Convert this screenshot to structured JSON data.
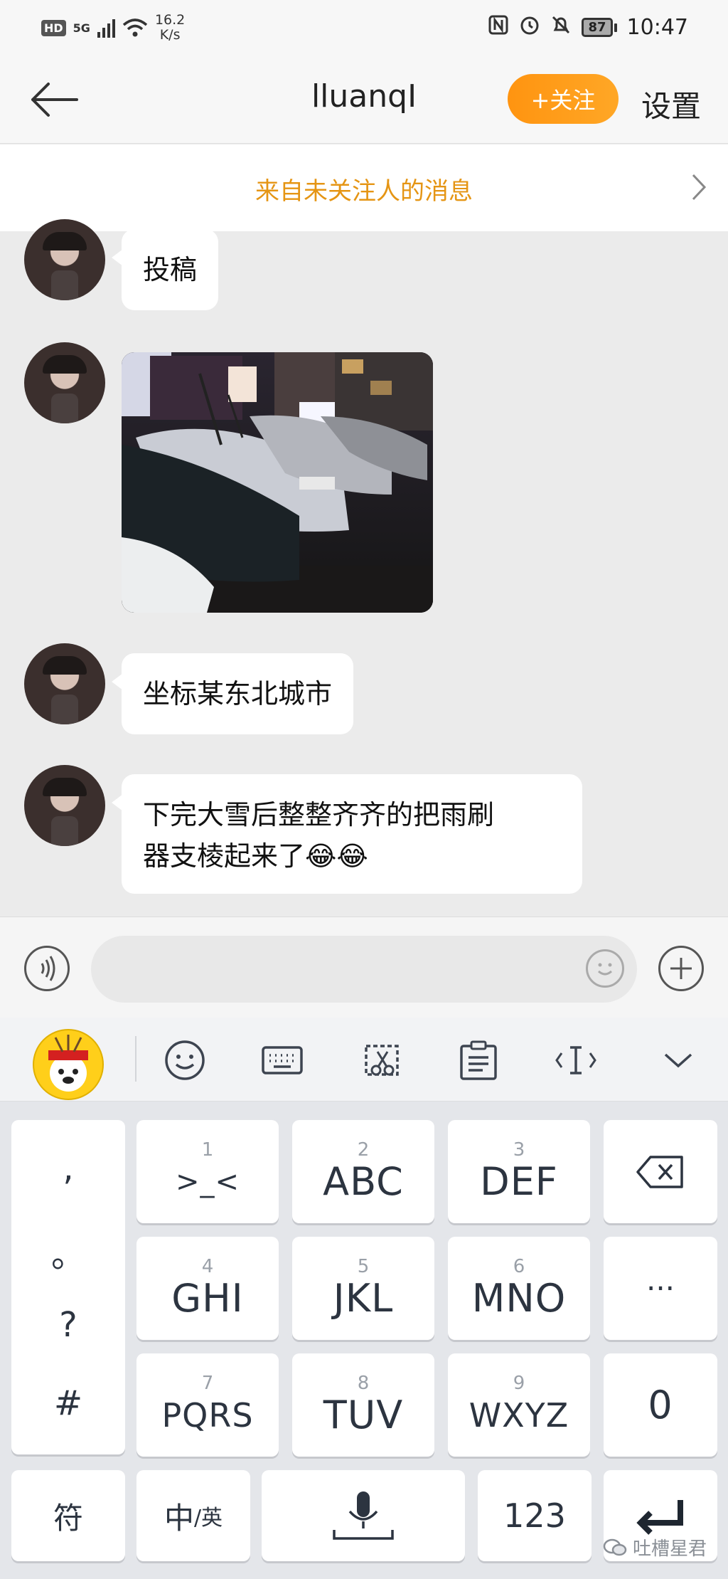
{
  "status_bar": {
    "hd": "HD",
    "network": "5G",
    "speed_value": "16.2",
    "speed_unit": "K/s",
    "nfc_icon": "nfc-icon",
    "alarm_icon": "alarm-icon",
    "mute_icon": "bell-off-icon",
    "battery": "87",
    "time": "10:47"
  },
  "header": {
    "back_icon": "back-arrow-icon",
    "title": "lluanqI",
    "follow_label": "+关注",
    "settings_label": "设置"
  },
  "banner": {
    "text": "来自未关注人的消息"
  },
  "messages": [
    {
      "type": "text",
      "text": "投稿"
    },
    {
      "type": "image",
      "alt": "parked cars at night"
    },
    {
      "type": "text",
      "text": "坐标某东北城市"
    },
    {
      "type": "text",
      "line1": "下完大雪后整整齐齐的把雨刷",
      "line2": "器支棱起来了😂😂"
    }
  ],
  "input_bar": {
    "voice_icon": "voice-icon",
    "placeholder": "",
    "emoji_icon": "emoji-icon",
    "plus_icon": "plus-icon"
  },
  "keyboard_toolbar": {
    "items": [
      "emoji-face-icon",
      "keyboard-icon",
      "clipboard-cut-icon",
      "clipboard-icon",
      "cursor-icon",
      "collapse-chevron-icon"
    ]
  },
  "keyboard": {
    "punctuation": [
      ",",
      "。",
      "?",
      "#"
    ],
    "row1": [
      {
        "num": "1",
        "label": ">_<"
      },
      {
        "num": "2",
        "label": "ABC"
      },
      {
        "num": "3",
        "label": "DEF"
      }
    ],
    "row2": [
      {
        "num": "4",
        "label": "GHI"
      },
      {
        "num": "5",
        "label": "JKL"
      },
      {
        "num": "6",
        "label": "MNO"
      }
    ],
    "row3": [
      {
        "num": "7",
        "label": "PQRS"
      },
      {
        "num": "8",
        "label": "TUV"
      },
      {
        "num": "9",
        "label": "WXYZ"
      }
    ],
    "ellipsis": "···",
    "zero": "0",
    "symbols": "符",
    "lang_cn": "中",
    "lang_en": "/英",
    "numbers": "123"
  },
  "watermark": "吐槽星君",
  "colors": {
    "accent": "#ff9a1a",
    "banner_text": "#e59514",
    "chat_bg": "#ebebeb"
  }
}
